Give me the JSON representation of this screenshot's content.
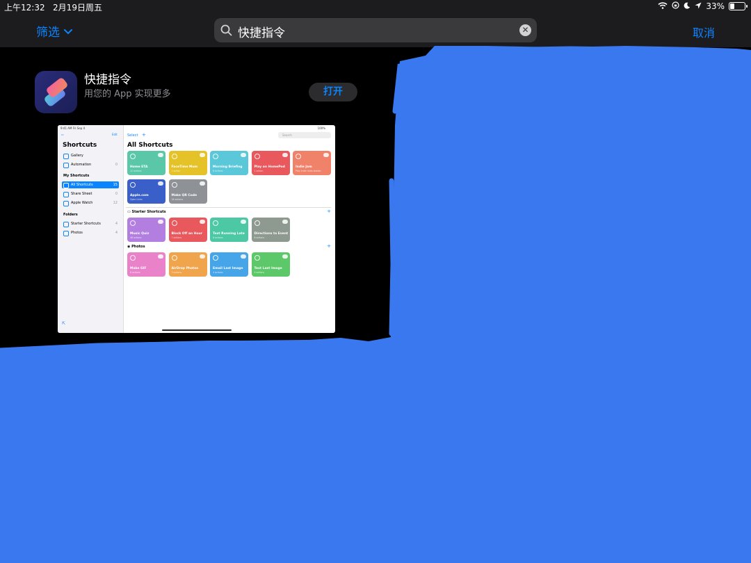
{
  "status_bar": {
    "time": "上午12:32",
    "date": "2月19日周五",
    "battery": "33%",
    "battery_level": 0.33
  },
  "nav": {
    "filter_label": "筛选",
    "search_value": "快捷指令",
    "cancel_label": "取消"
  },
  "result": {
    "name": "快捷指令",
    "subtitle": "用您的 App 实现更多",
    "button_label": "打开"
  },
  "preview": {
    "status_left": "9:41 AM   Fri Sep 4",
    "status_right": "100%",
    "edit_label": "Edit",
    "select_label": "Select",
    "search_placeholder": "Search",
    "sidebar_title": "Shortcuts",
    "sidebar_top": [
      {
        "label": "Gallery",
        "count": ""
      },
      {
        "label": "Automation",
        "count": "0"
      }
    ],
    "my_shortcuts_header": "My Shortcuts",
    "my_shortcuts": [
      {
        "label": "All Shortcuts",
        "count": "15",
        "selected": true
      },
      {
        "label": "Share Sheet",
        "count": "0",
        "selected": false
      },
      {
        "label": "Apple Watch",
        "count": "12",
        "selected": false
      }
    ],
    "folders_header": "Folders",
    "folders": [
      {
        "label": "Starter Shortcuts",
        "count": "4"
      },
      {
        "label": "Photos",
        "count": "4"
      }
    ],
    "main_title": "All Shortcuts",
    "row1": [
      {
        "title": "Home ETA",
        "sub": "12 actions",
        "color": "#5ac8a8"
      },
      {
        "title": "FaceTime Mom",
        "sub": "1 action",
        "color": "#e6c229"
      },
      {
        "title": "Morning Briefing",
        "sub": "6 actions",
        "color": "#5ac8d8"
      },
      {
        "title": "Play on HomePod",
        "sub": "1 action",
        "color": "#e8585d"
      },
      {
        "title": "Indie Jam",
        "sub": "Play indie radio station",
        "color": "#f0826a"
      }
    ],
    "row2": [
      {
        "title": "Apple.com",
        "sub": "Open Links",
        "color": "#3b5fc8"
      },
      {
        "title": "Make QR Code",
        "sub": "16 actions",
        "color": "#8e9296"
      }
    ],
    "starter_header": "Starter Shortcuts",
    "starter": [
      {
        "title": "Music Quiz",
        "sub": "48 actions",
        "color": "#b27ee0"
      },
      {
        "title": "Block Off an Hour",
        "sub": "7 actions",
        "color": "#e8585d"
      },
      {
        "title": "Text Running Late",
        "sub": "8 actions",
        "color": "#4cc9a4"
      },
      {
        "title": "Directions to Event",
        "sub": "8 actions",
        "color": "#8e9990"
      }
    ],
    "photos_header": "Photos",
    "photos": [
      {
        "title": "Make GIF",
        "sub": "6 actions",
        "color": "#e982c8"
      },
      {
        "title": "AirDrop Photos",
        "sub": "3 actions",
        "color": "#f0a44c"
      },
      {
        "title": "Email Last Image",
        "sub": "4 actions",
        "color": "#46a4e8"
      },
      {
        "title": "Text Last Image",
        "sub": "4 actions",
        "color": "#5cc86a"
      }
    ]
  },
  "colors": {
    "accent": "#0a84ff",
    "overlay": "#3a78ef"
  }
}
